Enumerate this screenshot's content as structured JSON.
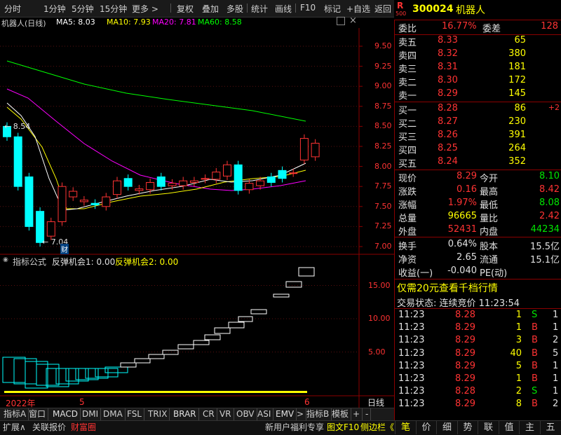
{
  "toolbar": {
    "items": [
      "分时",
      "1分钟",
      "5分钟",
      "15分钟",
      "更多 >",
      "复权",
      "叠加",
      "多股",
      "统计",
      "画线",
      "F10",
      "标记",
      "+自选",
      "返回"
    ]
  },
  "stock": {
    "code": "300024",
    "name": "机器人",
    "market_badge": "R",
    "market_badge_sub": "500"
  },
  "chart_header": {
    "title": "机器人(日线)",
    "ma5": "MA5: 8.03",
    "ma10": "MA10: 7.93",
    "ma20": "MA20: 7.81",
    "ma60": "MA60: 8.58",
    "colors": {
      "ma5": "#ffffff",
      "ma10": "#ffff00",
      "ma20": "#ff00ff",
      "ma60": "#00ff00"
    }
  },
  "price_axis": [
    "9.50",
    "9.25",
    "9.00",
    "8.75",
    "8.50",
    "8.25",
    "8.00",
    "7.75",
    "7.50",
    "7.25",
    "7.00"
  ],
  "annotations": {
    "high": "8.54",
    "low": "7.04",
    "cai": "财"
  },
  "indicator_header": {
    "title": "指标公式",
    "l1": "反弹机会1: 0.00",
    "l2": "反弹机会2: 0.00"
  },
  "indicator_axis": [
    "15.00",
    "10.00",
    "5.00"
  ],
  "date_axis": {
    "year": "2022年",
    "m5": "5",
    "m6": "6",
    "period": "日线"
  },
  "orderbook": {
    "weibi_label": "委比",
    "weibi": "16.77%",
    "weicha_label": "委差",
    "weicha": "128",
    "sell": [
      {
        "label": "卖五",
        "price": "8.33",
        "vol": "65"
      },
      {
        "label": "卖四",
        "price": "8.32",
        "vol": "380"
      },
      {
        "label": "卖三",
        "price": "8.31",
        "vol": "181"
      },
      {
        "label": "卖二",
        "price": "8.30",
        "vol": "172"
      },
      {
        "label": "卖一",
        "price": "8.29",
        "vol": "145"
      }
    ],
    "buy": [
      {
        "label": "买一",
        "price": "8.28",
        "vol": "86",
        "chg": "+2"
      },
      {
        "label": "买二",
        "price": "8.27",
        "vol": "230",
        "chg": ""
      },
      {
        "label": "买三",
        "price": "8.26",
        "vol": "391",
        "chg": ""
      },
      {
        "label": "买四",
        "price": "8.25",
        "vol": "264",
        "chg": ""
      },
      {
        "label": "买五",
        "price": "8.24",
        "vol": "352",
        "chg": ""
      }
    ]
  },
  "quote": {
    "rows": [
      {
        "l1": "现价",
        "v1": "8.29",
        "l2": "今开",
        "v2": "8.10",
        "c1": "red",
        "c2": "green"
      },
      {
        "l1": "涨跌",
        "v1": "0.16",
        "l2": "最高",
        "v2": "8.42",
        "c1": "red",
        "c2": "red"
      },
      {
        "l1": "涨幅",
        "v1": "1.97%",
        "l2": "最低",
        "v2": "8.08",
        "c1": "red",
        "c2": "green"
      },
      {
        "l1": "总量",
        "v1": "96665",
        "l2": "量比",
        "v2": "2.42",
        "c1": "yellow",
        "c2": "red"
      },
      {
        "l1": "外盘",
        "v1": "52431",
        "l2": "内盘",
        "v2": "44234",
        "c1": "red",
        "c2": "green"
      }
    ],
    "rows2": [
      {
        "l1": "换手",
        "v1": "0.64%",
        "l2": "股本",
        "v2": "15.5亿"
      },
      {
        "l1": "净资",
        "v1": "2.65",
        "l2": "流通",
        "v2": "15.1亿"
      },
      {
        "l1": "收益(一)",
        "v1": "-0.040",
        "l2": "PE(动)",
        "v2": ""
      }
    ]
  },
  "promo": "仅需20元查看千档行情",
  "trade_status": {
    "label": "交易状态: 连续竞价",
    "time": "11:23:54"
  },
  "ticks": [
    {
      "t": "11:23",
      "p": "8.28",
      "v": "1",
      "d": "S",
      "n": "1"
    },
    {
      "t": "11:23",
      "p": "8.29",
      "v": "1",
      "d": "B",
      "n": "1"
    },
    {
      "t": "11:23",
      "p": "8.29",
      "v": "3",
      "d": "B",
      "n": "2"
    },
    {
      "t": "11:23",
      "p": "8.29",
      "v": "40",
      "d": "B",
      "n": "5"
    },
    {
      "t": "11:23",
      "p": "8.29",
      "v": "5",
      "d": "B",
      "n": "1"
    },
    {
      "t": "11:23",
      "p": "8.29",
      "v": "1",
      "d": "B",
      "n": "1"
    },
    {
      "t": "11:23",
      "p": "8.28",
      "v": "2",
      "d": "S",
      "n": "1"
    },
    {
      "t": "11:23",
      "p": "8.29",
      "v": "8",
      "d": "B",
      "n": "2"
    }
  ],
  "bottom_tabs": [
    "指标A",
    "窗口",
    "MACD",
    "DMI",
    "DMA",
    "FSL",
    "TRIX",
    "BRAR",
    "CR",
    "VR",
    "OBV",
    "ASI",
    "EMV",
    ">",
    "指标B",
    "模板",
    "+",
    "-"
  ],
  "bottom_bar": {
    "expand": "扩展∧",
    "relate": "关联报价",
    "fin": "财富圈",
    "news": "新用户福利专享",
    "f10": "图文F10",
    "side": "侧边栏《"
  },
  "right_tabs": [
    "笔",
    "价",
    "细",
    "势",
    "联",
    "值",
    "主",
    "五"
  ],
  "chart_data": {
    "type": "candlestick",
    "candles": [
      {
        "o": 8.5,
        "c": 8.37
      },
      {
        "o": 8.37,
        "c": 7.75
      },
      {
        "o": 7.87,
        "c": 7.25
      },
      {
        "o": 7.44,
        "c": 7.05
      },
      {
        "o": 7.13,
        "c": 7.31
      },
      {
        "o": 7.31,
        "c": 7.75
      },
      {
        "o": 7.62,
        "c": 7.69
      },
      {
        "o": 7.56,
        "c": 7.58
      },
      {
        "o": 7.54,
        "c": 7.52
      },
      {
        "o": 7.5,
        "c": 7.62
      },
      {
        "o": 7.65,
        "c": 7.82
      },
      {
        "o": 7.85,
        "c": 7.75
      },
      {
        "o": 7.7,
        "c": 7.72
      },
      {
        "o": 7.71,
        "c": 7.8
      },
      {
        "o": 7.87,
        "c": 7.75
      },
      {
        "o": 7.76,
        "c": 7.79
      },
      {
        "o": 7.76,
        "c": 7.82
      },
      {
        "o": 7.8,
        "c": 7.82
      },
      {
        "o": 7.84,
        "c": 7.85
      },
      {
        "o": 7.84,
        "c": 7.93
      },
      {
        "o": 7.88,
        "c": 8.02
      },
      {
        "o": 8.02,
        "c": 7.7
      },
      {
        "o": 7.71,
        "c": 7.79
      },
      {
        "o": 7.76,
        "c": 7.82
      },
      {
        "o": 7.87,
        "c": 7.8
      },
      {
        "o": 7.95,
        "c": 7.85
      },
      {
        "o": 7.92,
        "c": 7.92
      },
      {
        "o": 8.08,
        "c": 8.35
      },
      {
        "o": 8.12,
        "c": 8.29
      }
    ],
    "ylim": [
      7.0,
      9.5
    ]
  }
}
